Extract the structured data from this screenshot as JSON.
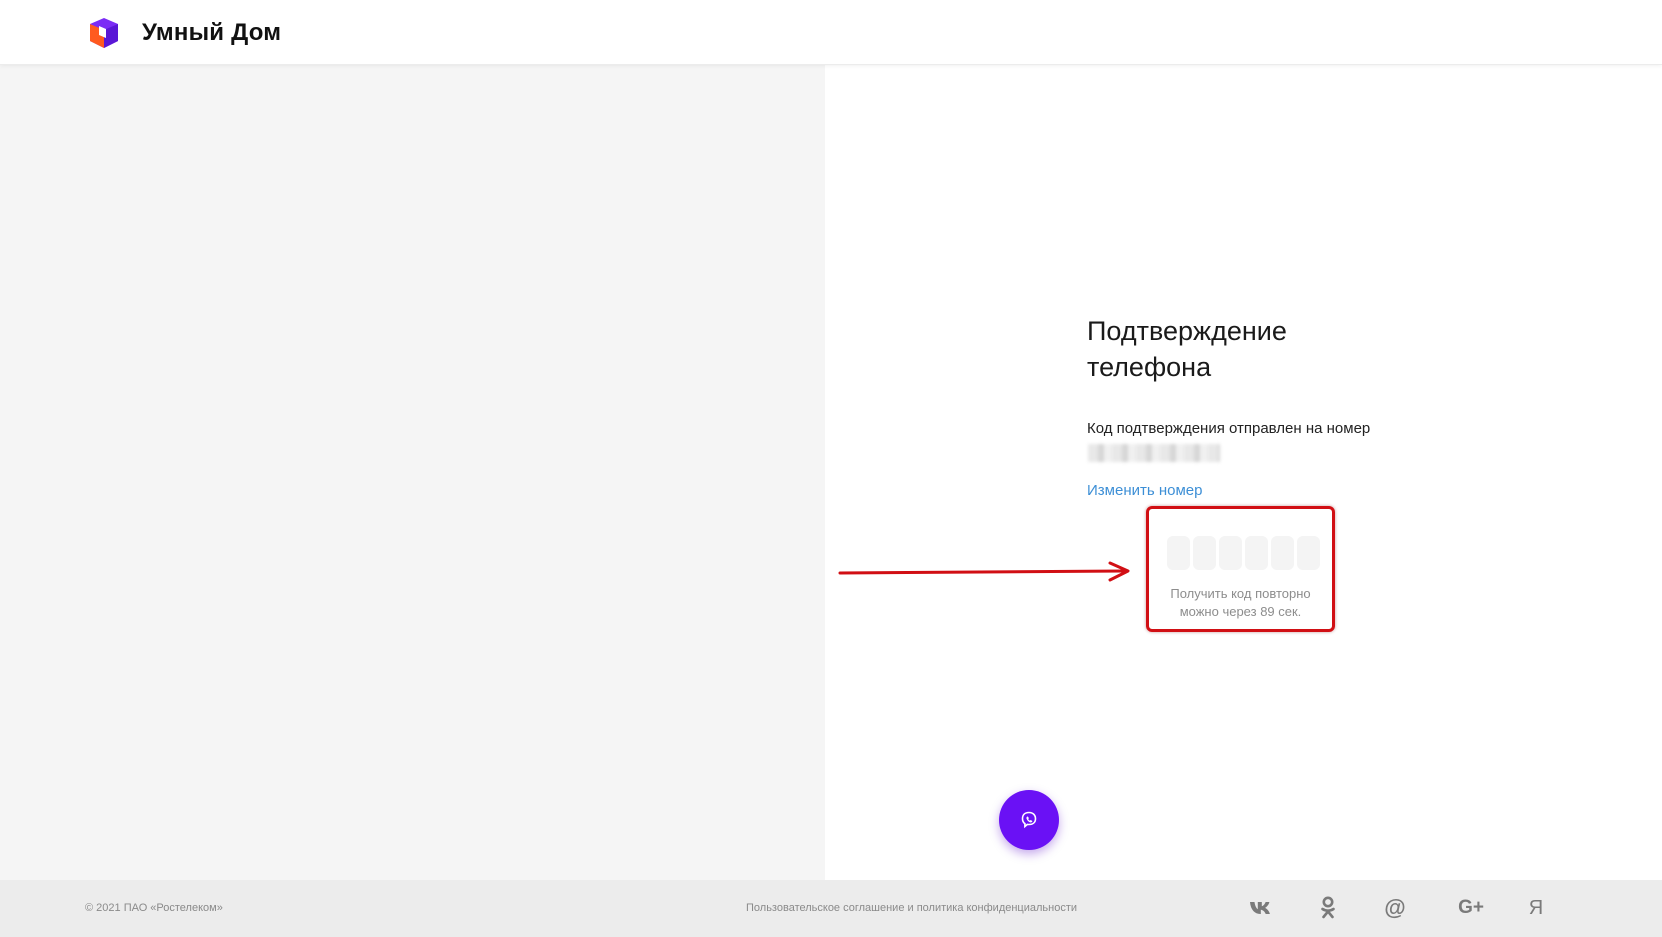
{
  "header": {
    "brand": "Умный Дом"
  },
  "confirm": {
    "title": "Подтверждение телефона",
    "sent_text": "Код подтверждения отправлен на номер",
    "change_link": "Изменить номер",
    "code_cells": [
      "",
      "",
      "",
      "",
      "",
      ""
    ],
    "resend_line1": "Получить код повторно",
    "resend_line2": "можно через 89 сек."
  },
  "footer": {
    "copyright": "© 2021 ПАО «Ростелеком»",
    "policy": "Пользовательское соглашение и политика конфиденциальности",
    "social": {
      "google": "G+",
      "yandex": "Я",
      "mail": "@"
    }
  },
  "colors": {
    "accent_purple": "#6a11f5",
    "link_blue": "#3d8fd6",
    "highlight_red": "#d10f14",
    "logo_orange": "#ff5a1f"
  },
  "icons": [
    "rostelecom-logo-icon",
    "viber-icon",
    "vk-icon",
    "odnoklassniki-icon",
    "mail-ru-icon",
    "google-plus-icon",
    "yandex-icon",
    "arrow-annotation-icon"
  ]
}
